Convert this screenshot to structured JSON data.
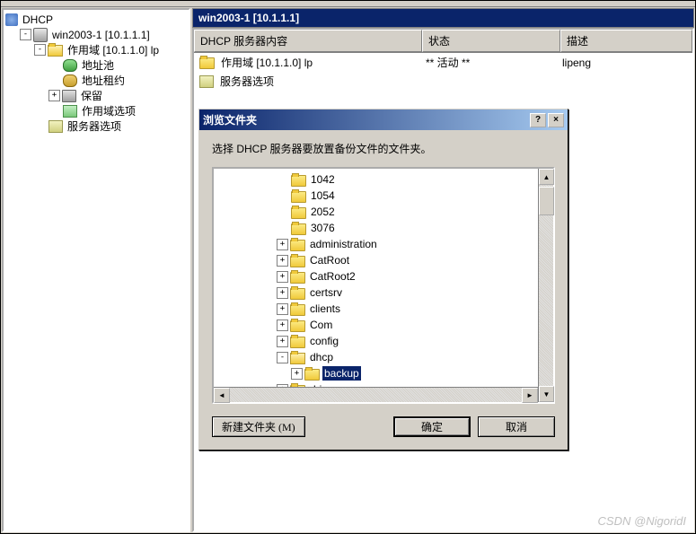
{
  "tree": {
    "root": "DHCP",
    "server": "win2003-1 [10.1.1.1]",
    "scope": "作用域 [10.1.1.0] lp",
    "pool": "地址池",
    "lease": "地址租约",
    "reserve": "保留",
    "scopeopts": "作用域选项",
    "srvopts": "服务器选项"
  },
  "header": {
    "title": "win2003-1 [10.1.1.1]"
  },
  "columns": {
    "c1": "DHCP 服务器内容",
    "c2": "状态",
    "c3": "描述"
  },
  "rows": [
    {
      "name": "作用域 [10.1.1.0] lp",
      "status": "** 活动 **",
      "desc": "lipeng"
    },
    {
      "name": "服务器选项",
      "status": "",
      "desc": ""
    }
  ],
  "dialog": {
    "title": "浏览文件夹",
    "prompt": "选择 DHCP 服务器要放置备份文件的文件夹。",
    "newfolder": "新建文件夹 (M)",
    "ok": "确定",
    "cancel": "取消",
    "folders": [
      "1042",
      "1054",
      "2052",
      "3076",
      "administration",
      "CatRoot",
      "CatRoot2",
      "certsrv",
      "clients",
      "Com",
      "config"
    ],
    "dhcp": "dhcp",
    "backup": "backup",
    "drivers_partial": "drivers"
  },
  "titlebtns": {
    "help": "?",
    "close": "×"
  },
  "watermark": "CSDN @NigoridI"
}
